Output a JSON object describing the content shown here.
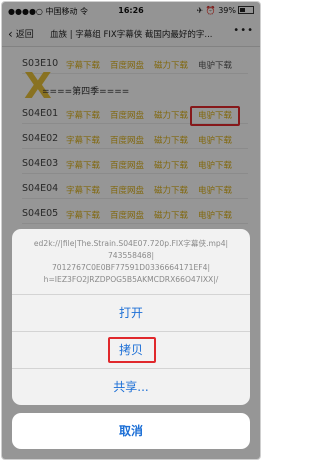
{
  "status": {
    "carrier": "●●●●○ 中国移动 令",
    "time": "16:26",
    "battery": "✈ ⏰ 39%"
  },
  "nav": {
    "back_label": "返回",
    "title": "血族 | 字幕组 FIX字幕侠 截国内最好的字...",
    "more": "•••"
  },
  "content": {
    "top_row": {
      "episode": "S03E10",
      "links": [
        "字幕下载",
        "百度网盘",
        "磁力下载",
        "电驴下载"
      ]
    },
    "season_sep": "====第四季====",
    "rows": [
      {
        "episode": "S04E01",
        "links": [
          "字幕下载",
          "百度网盘",
          "磁力下载",
          "电驴下载"
        ]
      },
      {
        "episode": "S04E02",
        "links": [
          "字幕下载",
          "百度网盘",
          "磁力下载",
          "电驴下载"
        ]
      },
      {
        "episode": "S04E03",
        "links": [
          "字幕下载",
          "百度网盘",
          "磁力下载",
          "电驴下载"
        ]
      },
      {
        "episode": "S04E04",
        "links": [
          "字幕下载",
          "百度网盘",
          "磁力下载",
          "电驴下载"
        ]
      },
      {
        "episode": "S04E05",
        "links": [
          "字幕下载",
          "百度网盘",
          "磁力下载",
          "电驴下载"
        ]
      }
    ]
  },
  "sheet": {
    "message_lines": [
      "ed2k://|file|The.Strain.S04E07.720p.FIX字幕侠.mp4|",
      "743558468|",
      "7012767C0E0BF77591D0336664171EF4|",
      "h=IEZ3FO2JRZDPOG5B5AKMCDRX66O47IXX|/"
    ],
    "open_label": "打开",
    "copy_label": "拷贝",
    "share_label": "共享...",
    "cancel_label": "取消"
  },
  "colors": {
    "link": "#d8ad17",
    "accent": "#1c6fd6",
    "highlight": "#e0282c"
  }
}
